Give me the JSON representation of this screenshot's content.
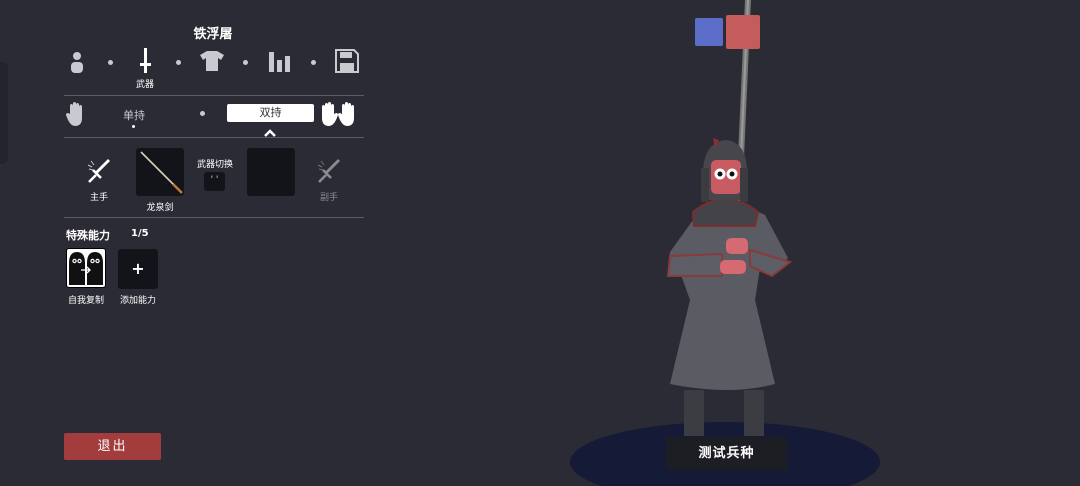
{
  "unit_name": "铁浮屠",
  "steps": {
    "weapon_label": "武器"
  },
  "grip": {
    "single": "单持",
    "dual": "双持"
  },
  "weapons": {
    "main_label": "主手",
    "main_weapon_name": "龙泉剑",
    "switch_label": "武器切换",
    "switch_key": "' '",
    "off_label": "副手"
  },
  "abilities": {
    "title": "特殊能力",
    "count": "1/5",
    "items": [
      {
        "label": "自我复制"
      },
      {
        "label": "添加能力",
        "symbol": "+"
      }
    ]
  },
  "buttons": {
    "exit": "退出",
    "test": "测试兵种"
  },
  "team_colors": {
    "blue": "#5c6cc9",
    "red": "#c45c5c"
  },
  "icons": {
    "steps": [
      "unit-icon",
      "weapon-icon",
      "armor-icon",
      "stats-icon",
      "save-icon"
    ],
    "grip": [
      "single-hand-icon",
      "dual-hands-icon"
    ],
    "hands": [
      "main-hand-sword-icon",
      "off-hand-sword-icon"
    ]
  }
}
